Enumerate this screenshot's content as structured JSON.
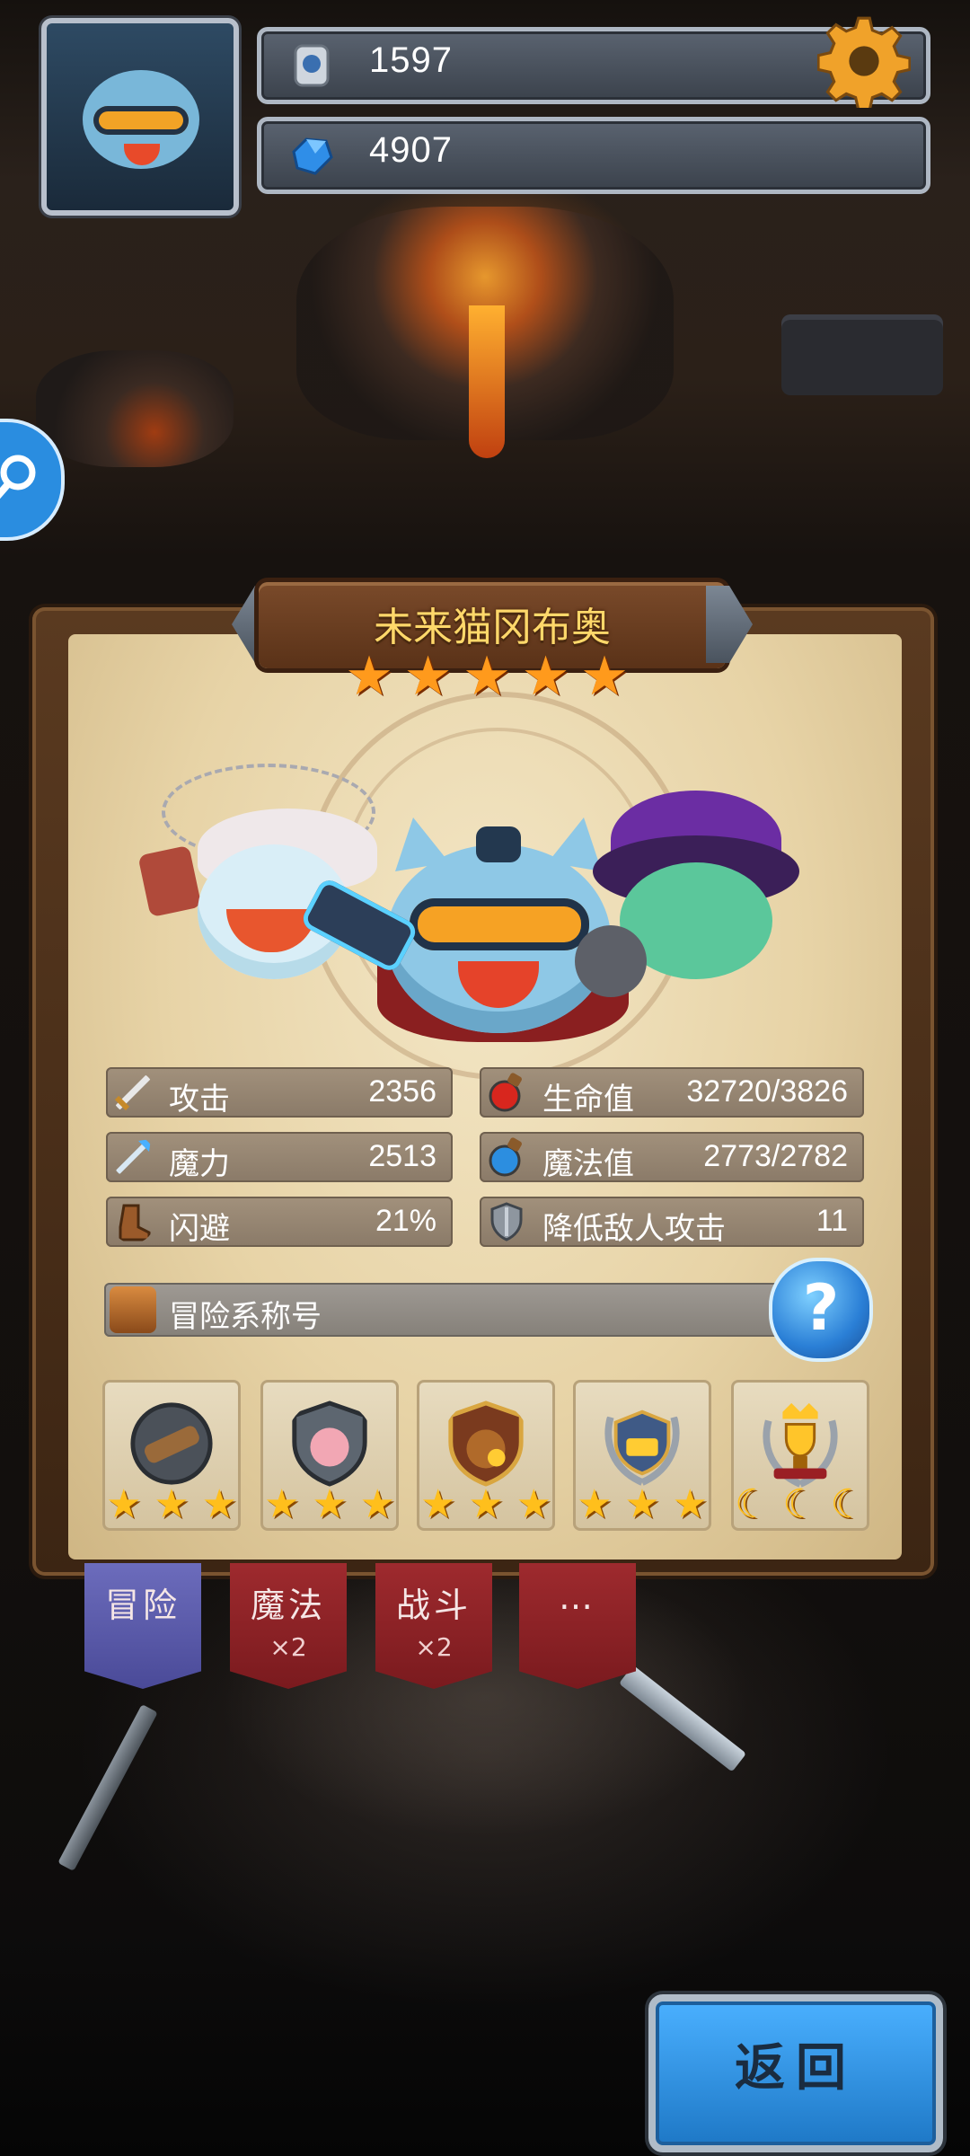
{
  "resources": {
    "silver_value": "1597",
    "gem_value": "4907"
  },
  "hero": {
    "name": "未来猫冈布奥",
    "stars": 5
  },
  "stats": [
    {
      "icon": "sword-icon",
      "label": "攻击",
      "value": "2356"
    },
    {
      "icon": "hp-potion-icon",
      "label": "生命值",
      "value": "32720/3826"
    },
    {
      "icon": "magic-wand-icon",
      "label": "魔力",
      "value": "2513"
    },
    {
      "icon": "mp-potion-icon",
      "label": "魔法值",
      "value": "2773/2782"
    },
    {
      "icon": "boot-icon",
      "label": "闪避",
      "value": "21%"
    },
    {
      "icon": "shield-icon",
      "label": "降低敌人攻击",
      "value": "11"
    }
  ],
  "title_section": {
    "label": "冒险系称号",
    "help_label": "?"
  },
  "badges": [
    {
      "icon": "spyglass-badge-icon",
      "stars": "★★★"
    },
    {
      "icon": "pig-shield-badge-icon",
      "stars": "★★★"
    },
    {
      "icon": "money-bag-badge-icon",
      "stars": "★★★"
    },
    {
      "icon": "treasure-laurel-badge-icon",
      "stars": "★★★"
    },
    {
      "icon": "trophy-crown-badge-icon",
      "stars": "☾☾☾"
    }
  ],
  "tabs": [
    {
      "label": "冒险",
      "multiplier": "",
      "color": "#5a5aa8",
      "active": true
    },
    {
      "label": "魔法",
      "multiplier": "×2",
      "color": "#8e1f24",
      "active": false
    },
    {
      "label": "战斗",
      "multiplier": "×2",
      "color": "#8e1f24",
      "active": false
    },
    {
      "label": "…",
      "multiplier": "",
      "color": "#8e1f24",
      "active": false
    }
  ],
  "back_button": "返回",
  "colors": {
    "star": "#ff9a1c",
    "name_gold": "#ffd86a",
    "parchment": "#e7d3a6",
    "help_blue": "#2a7fd6"
  }
}
